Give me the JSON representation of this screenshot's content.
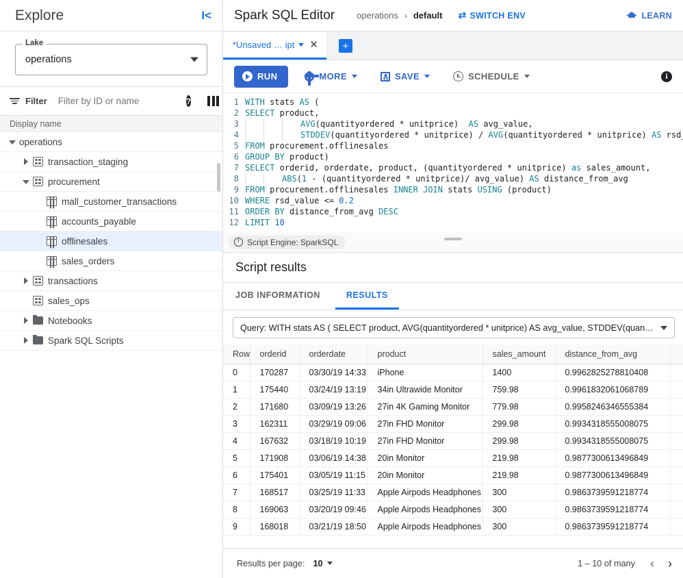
{
  "sidebar": {
    "title": "Explore",
    "collapse_icon": "chevron-left-bar",
    "lake": {
      "legend": "Lake",
      "value": "operations"
    },
    "filter": {
      "label": "Filter",
      "placeholder": "Filter by ID or name",
      "value": ""
    },
    "tree_header": "Display name",
    "tree": [
      {
        "label": "operations",
        "icon": "none",
        "caret": "down",
        "indent": 0,
        "selected": false
      },
      {
        "label": "transaction_staging",
        "icon": "database",
        "caret": "right",
        "indent": 1,
        "selected": false
      },
      {
        "label": "procurement",
        "icon": "database",
        "caret": "down",
        "indent": 1,
        "selected": false
      },
      {
        "label": "mall_customer_transactions",
        "icon": "table",
        "caret": "none",
        "indent": 2,
        "selected": false
      },
      {
        "label": "accounts_payable",
        "icon": "table",
        "caret": "none",
        "indent": 2,
        "selected": false
      },
      {
        "label": "offlinesales",
        "icon": "table",
        "caret": "none",
        "indent": 2,
        "selected": true
      },
      {
        "label": "sales_orders",
        "icon": "table",
        "caret": "none",
        "indent": 2,
        "selected": false
      },
      {
        "label": "transactions",
        "icon": "database",
        "caret": "right",
        "indent": 1,
        "selected": false
      },
      {
        "label": "sales_ops",
        "icon": "database",
        "caret": "none",
        "indent": 1,
        "selected": false
      },
      {
        "label": "Notebooks",
        "icon": "folder",
        "caret": "right",
        "indent": 1,
        "selected": false
      },
      {
        "label": "Spark SQL Scripts",
        "icon": "folder",
        "caret": "right",
        "indent": 1,
        "selected": false
      }
    ]
  },
  "header": {
    "app_title": "Spark SQL Editor",
    "breadcrumb_project": "operations",
    "breadcrumb_sep": "›",
    "breadcrumb_current": "default",
    "switch_env": "SWITCH ENV",
    "switch_env_icon": "swap-icon",
    "learn": "LEARN",
    "learn_icon": "graduation-cap-icon"
  },
  "tabstrip": {
    "tab_label": "*Unsaved … ipt",
    "tab_caret_icon": "chevron-down-icon",
    "tab_close_icon": "close-icon",
    "add_tab_icon": "plus-icon"
  },
  "toolbar": {
    "run": "RUN",
    "run_icon": "play-circle-icon",
    "more": "MORE",
    "more_icon": "gear-icon",
    "save": "SAVE",
    "save_icon": "save-disk-icon",
    "schedule": "SCHEDULE",
    "schedule_icon": "clock-icon",
    "info_icon": "info-icon"
  },
  "editor": {
    "lines": [
      {
        "n": "1",
        "tokens": [
          {
            "t": "WITH",
            "c": "kw"
          },
          {
            "t": " stats ",
            "c": ""
          },
          {
            "t": "AS",
            "c": "kw"
          },
          {
            "t": " (",
            "c": ""
          }
        ]
      },
      {
        "n": "2",
        "tokens": [
          {
            "t": "SELECT",
            "c": "kw"
          },
          {
            "t": " product,",
            "c": ""
          }
        ]
      },
      {
        "n": "3",
        "tokens": [
          {
            "t": "|||",
            "c": "guide"
          },
          {
            "t": "AVG",
            "c": "kw"
          },
          {
            "t": "(quantityordered * unitprice)  ",
            "c": ""
          },
          {
            "t": "AS",
            "c": "kw"
          },
          {
            "t": " avg_value,",
            "c": ""
          }
        ]
      },
      {
        "n": "4",
        "tokens": [
          {
            "t": "|||",
            "c": "guide"
          },
          {
            "t": "STDDEV",
            "c": "kw"
          },
          {
            "t": "(quantityordered * unitprice) / ",
            "c": ""
          },
          {
            "t": "AVG",
            "c": "kw"
          },
          {
            "t": "(quantityordered * unitprice) ",
            "c": ""
          },
          {
            "t": "AS",
            "c": "kw"
          },
          {
            "t": " rsd_v",
            "c": ""
          }
        ]
      },
      {
        "n": "5",
        "tokens": [
          {
            "t": "FROM",
            "c": "kw"
          },
          {
            "t": " procurement.offlinesales",
            "c": ""
          }
        ]
      },
      {
        "n": "6",
        "tokens": [
          {
            "t": "GROUP BY",
            "c": "kw"
          },
          {
            "t": " product)",
            "c": ""
          }
        ]
      },
      {
        "n": "7",
        "tokens": [
          {
            "t": "SELECT",
            "c": "kw"
          },
          {
            "t": " orderid, orderdate, product, (quantityordered * unitprice) ",
            "c": ""
          },
          {
            "t": "as",
            "c": "kw"
          },
          {
            "t": " sales_amount,",
            "c": ""
          }
        ]
      },
      {
        "n": "8",
        "tokens": [
          {
            "t": "||",
            "c": "guide"
          },
          {
            "t": "ABS",
            "c": "kw"
          },
          {
            "t": "(",
            "c": ""
          },
          {
            "t": "1",
            "c": "num"
          },
          {
            "t": " - (quantityordered * unitprice)/ avg_value) ",
            "c": ""
          },
          {
            "t": "AS",
            "c": "kw"
          },
          {
            "t": " distance_from_avg",
            "c": ""
          }
        ]
      },
      {
        "n": "9",
        "tokens": [
          {
            "t": "FROM",
            "c": "kw"
          },
          {
            "t": " procurement.offlinesales ",
            "c": ""
          },
          {
            "t": "INNER JOIN",
            "c": "kw"
          },
          {
            "t": " stats ",
            "c": ""
          },
          {
            "t": "USING",
            "c": "kw"
          },
          {
            "t": " (product)",
            "c": ""
          }
        ]
      },
      {
        "n": "10",
        "tokens": [
          {
            "t": "WHERE",
            "c": "kw"
          },
          {
            "t": " rsd_value <= ",
            "c": ""
          },
          {
            "t": "0.2",
            "c": "num"
          }
        ]
      },
      {
        "n": "11",
        "tokens": [
          {
            "t": "ORDER BY",
            "c": "kw"
          },
          {
            "t": " distance_from_avg ",
            "c": ""
          },
          {
            "t": "DESC",
            "c": "kw"
          }
        ]
      },
      {
        "n": "12",
        "tokens": [
          {
            "t": "LIMIT",
            "c": "kw"
          },
          {
            "t": " ",
            "c": ""
          },
          {
            "t": "10",
            "c": "num"
          }
        ]
      }
    ],
    "engine_chip": "Script Engine: SparkSQL",
    "engine_chip_icon": "info-circle-icon",
    "resize_handle_icon": "drag-handle-icon"
  },
  "results": {
    "title": "Script results",
    "tabs": [
      {
        "label": "JOB INFORMATION",
        "active": false
      },
      {
        "label": "RESULTS",
        "active": true
      }
    ],
    "query_select": {
      "value": "Query: WITH stats AS ( SELECT product, AVG(quantityordered * unitprice) AS avg_value, STDDEV(quantityorder…",
      "caret_icon": "chevron-down-icon"
    },
    "columns": [
      "Row",
      "orderid",
      "orderdate",
      "product",
      "sales_amount",
      "distance_from_avg",
      ""
    ],
    "rows": [
      [
        "0",
        "170287",
        "03/30/19 14:33",
        "iPhone",
        "1400",
        "0.9962825278810408",
        ""
      ],
      [
        "1",
        "175440",
        "03/24/19 13:19",
        "34in Ultrawide Monitor",
        "759.98",
        "0.9961832061068789",
        ""
      ],
      [
        "2",
        "171680",
        "03/09/19 13:26",
        "27in 4K Gaming Monitor",
        "779.98",
        "0.9958246346555384",
        ""
      ],
      [
        "3",
        "162311",
        "03/29/19 09:06",
        "27in FHD Monitor",
        "299.98",
        "0.9934318555008075",
        ""
      ],
      [
        "4",
        "167632",
        "03/18/19 10:19",
        "27in FHD Monitor",
        "299.98",
        "0.9934318555008075",
        ""
      ],
      [
        "5",
        "171908",
        "03/06/19 14:38",
        "20in Monitor",
        "219.98",
        "0.9877300613496849",
        ""
      ],
      [
        "6",
        "175401",
        "03/05/19 11:15",
        "20in Monitor",
        "219.98",
        "0.9877300613496849",
        ""
      ],
      [
        "7",
        "168517",
        "03/25/19 11:33",
        "Apple Airpods Headphones",
        "300",
        "0.9863739591218774",
        ""
      ],
      [
        "8",
        "169063",
        "03/20/19 09:46",
        "Apple Airpods Headphones",
        "300",
        "0.9863739591218774",
        ""
      ],
      [
        "9",
        "168018",
        "03/21/19 18:50",
        "Apple Airpods Headphones",
        "300",
        "0.9863739591218774",
        ""
      ]
    ],
    "pager": {
      "label": "Results per page:",
      "page_size": "10",
      "page_size_caret_icon": "chevron-down-icon",
      "range": "1 – 10 of many",
      "prev_icon": "‹",
      "next_icon": "›"
    }
  },
  "colors": {
    "accent_blue": "#1a73e8",
    "run_blue": "#3366cc",
    "selected_row": "#e8f0fe",
    "sql_keyword": "#17838f"
  }
}
